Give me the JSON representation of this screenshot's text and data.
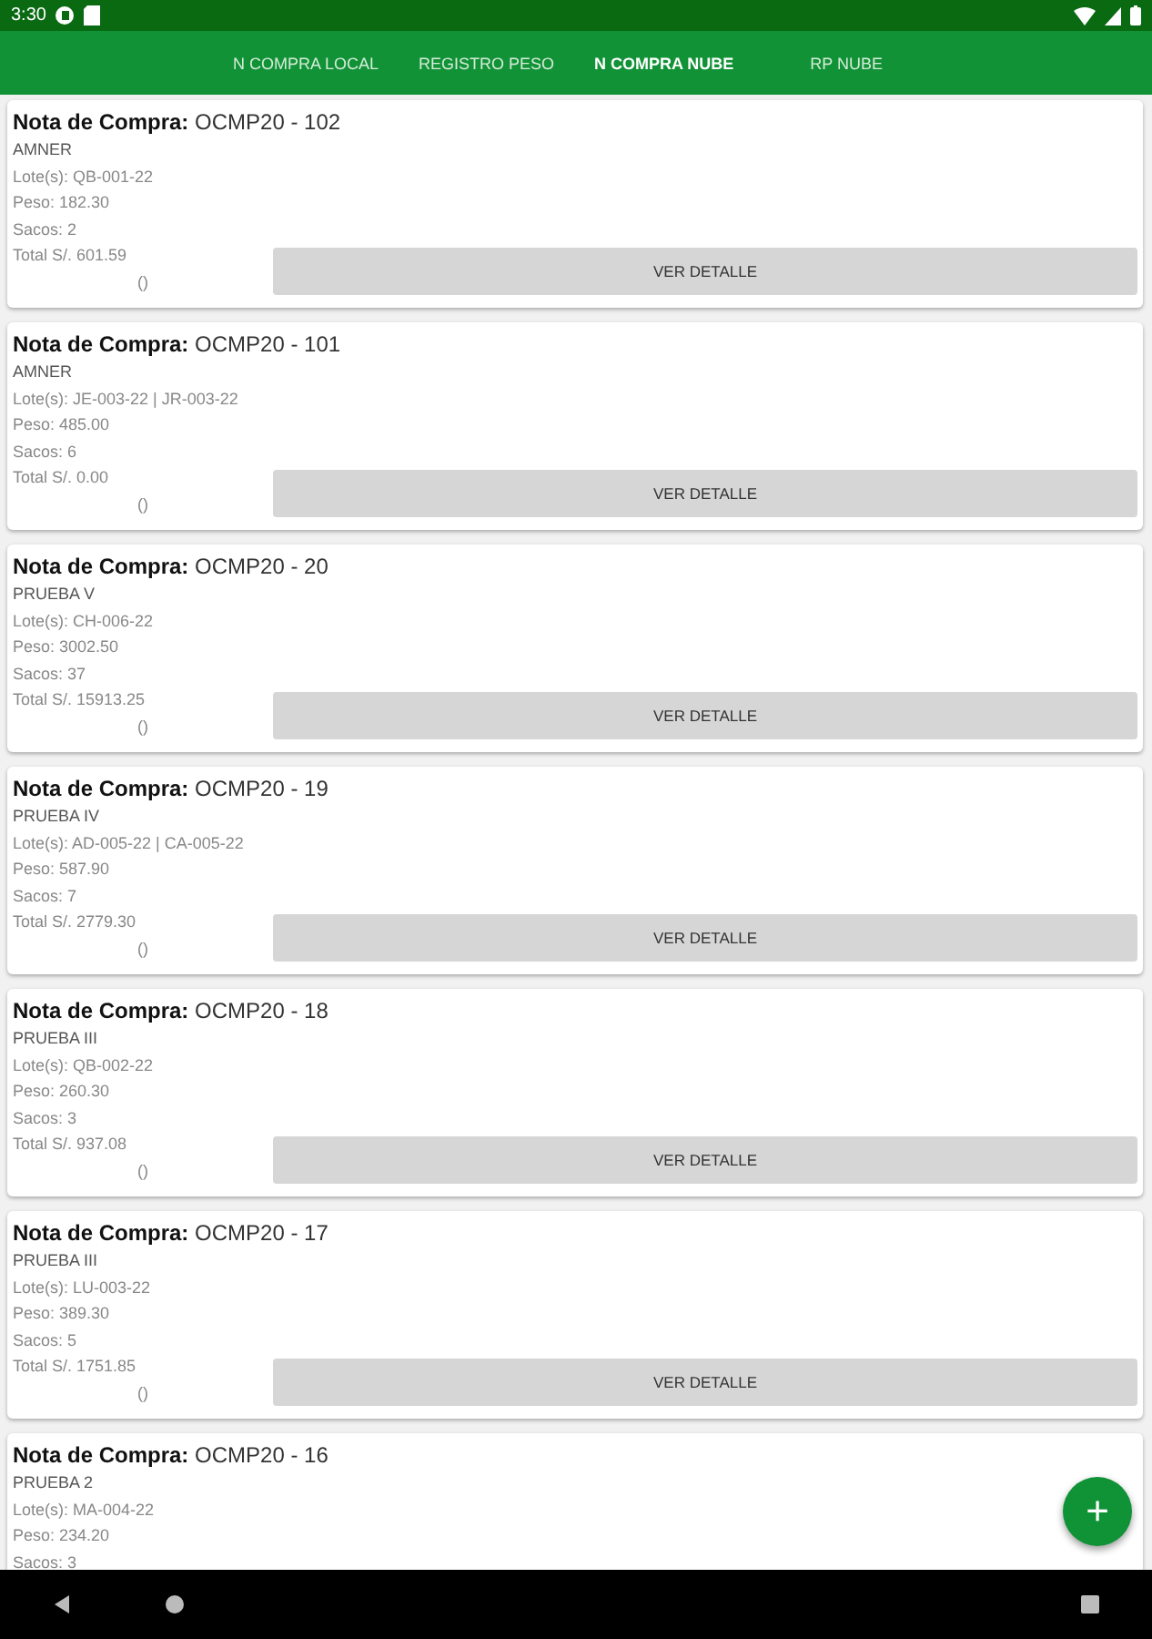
{
  "status_bar": {
    "time": "3:30"
  },
  "tabs": [
    {
      "label": "N COMPRA LOCAL",
      "selected": false
    },
    {
      "label": "REGISTRO PESO",
      "selected": false
    },
    {
      "label": "N COMPRA NUBE",
      "selected": true
    },
    {
      "label": "RP NUBE",
      "selected": false
    }
  ],
  "cards": [
    {
      "title": "**Nota de Compra:** OCMP20 - 102",
      "name": "AMNER",
      "lines": [
        "Lote(s):  QB-001-22",
        "Peso: 182.30",
        "Sacos: 2",
        "Total S/. 601.59"
      ],
      "extra": "()",
      "button": "VER DETALLE"
    },
    {
      "title": "**Nota de Compra:** OCMP20 - 101",
      "name": "AMNER",
      "lines": [
        "Lote(s):  JE-003-22 | JR-003-22",
        "Peso: 485.00",
        "Sacos: 6",
        "Total S/. 0.00"
      ],
      "extra": "()",
      "button": "VER DETALLE"
    },
    {
      "title": "**Nota de Compra:** OCMP20 - 20",
      "name": "PRUEBA V",
      "lines": [
        "Lote(s):  CH-006-22",
        "Peso: 3002.50",
        "Sacos: 37",
        "Total S/. 15913.25"
      ],
      "extra": "()",
      "button": "VER DETALLE"
    },
    {
      "title": "**Nota de Compra:** OCMP20 - 19",
      "name": "PRUEBA IV",
      "lines": [
        "Lote(s):  AD-005-22 | CA-005-22",
        "Peso: 587.90",
        "Sacos: 7",
        "Total S/. 2779.30"
      ],
      "extra": "()",
      "button": "VER DETALLE"
    },
    {
      "title": "**Nota de Compra:** OCMP20 - 18",
      "name": "PRUEBA III",
      "lines": [
        "Lote(s):  QB-002-22",
        "Peso: 260.30",
        "Sacos: 3",
        "Total S/. 937.08"
      ],
      "extra": "()",
      "button": "VER DETALLE"
    },
    {
      "title": "**Nota de Compra:** OCMP20 - 17",
      "name": "PRUEBA III",
      "lines": [
        "Lote(s):  LU-003-22",
        "Peso: 389.30",
        "Sacos: 5",
        "Total S/. 1751.85"
      ],
      "extra": "()",
      "button": "VER DETALLE"
    },
    {
      "title": "**Nota de Compra:** OCMP20 - 16",
      "name": "PRUEBA 2",
      "lines": [
        "Lote(s):  MA-004-22",
        "Peso: 234.20",
        "Sacos: 3"
      ]
    }
  ],
  "fab": {
    "label": "+"
  }
}
